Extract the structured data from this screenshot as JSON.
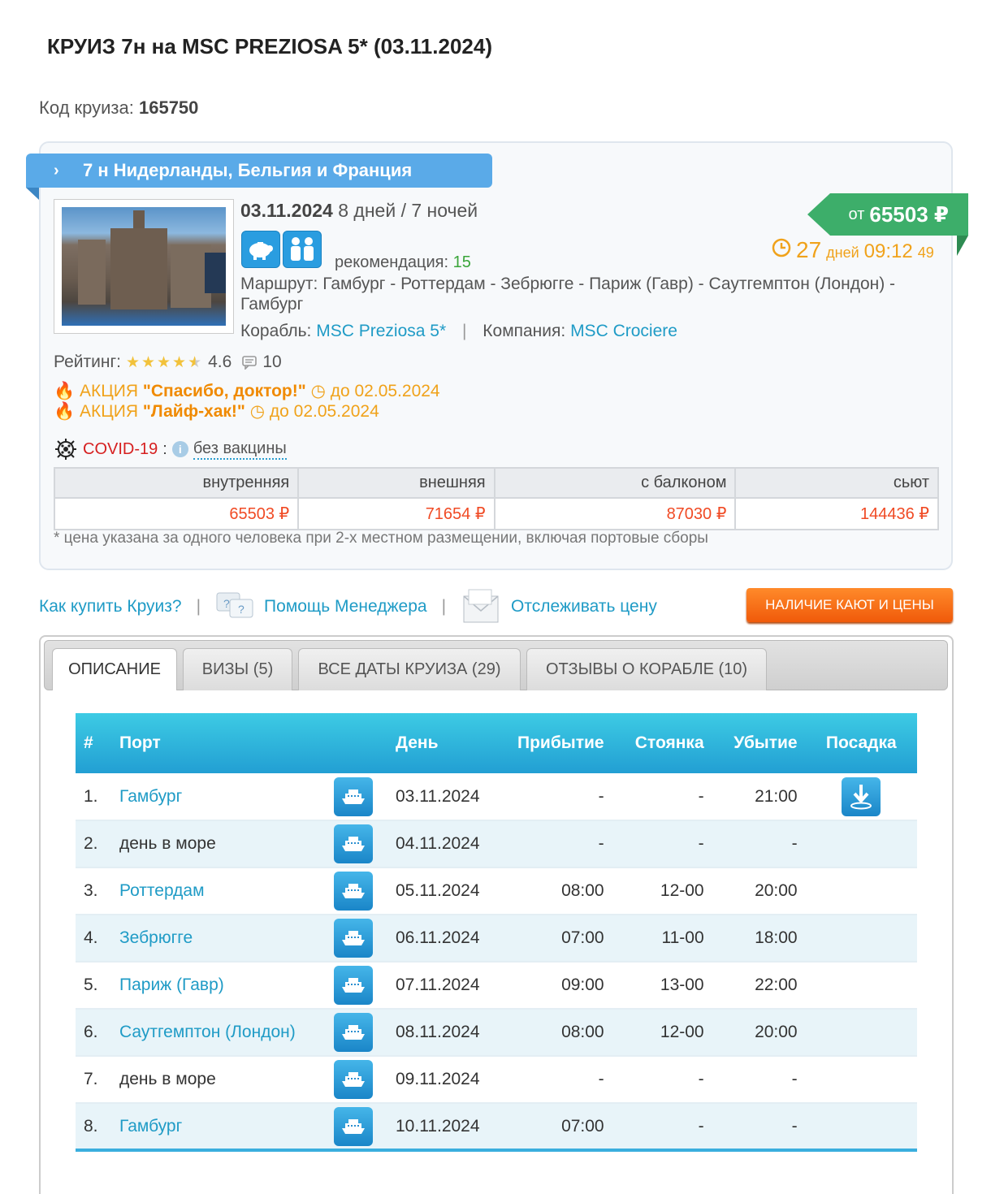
{
  "title": "КРУИЗ 7н на MSC PREZIOSA 5* (03.11.2024)",
  "code_label": "Код круиза:",
  "code_value": "165750",
  "ribbon": "7 н Нидерланды, Бельгия и Франция",
  "date": "03.11.2024",
  "duration": "8 дней / 7 ночей",
  "recommend_label": "рекомендация:",
  "recommend_value": "15",
  "price_from_label": "от",
  "price_from_value": "65503",
  "currency": "₽",
  "countdown": {
    "days": "27",
    "days_label": "дней",
    "time": "09:12",
    "seconds": "49"
  },
  "route_label": "Маршрут:",
  "route_value": "Гамбург - Роттердам - Зебрюгге - Париж (Гавр) - Саутгемптон (Лондон) - Гамбург",
  "ship_label": "Корабль:",
  "ship_value": "MSC Preziosa 5*",
  "company_label": "Компания:",
  "company_value": "MSC Crociere",
  "rating_label": "Рейтинг:",
  "rating_value": "4.6",
  "review_count": "10",
  "rating_stars": 4.5,
  "promos": [
    {
      "prefix": "АКЦИЯ",
      "name": "\"Спасибо, доктор!\"",
      "until": "до 02.05.2024"
    },
    {
      "prefix": "АКЦИЯ",
      "name": "\"Лайф-хак!\"",
      "until": "до 02.05.2024"
    }
  ],
  "covid_label": "COVID-19",
  "covid_sep": ":",
  "covid_value": "без вакцины",
  "cabins": {
    "headers": [
      "внутренняя",
      "внешняя",
      "с балконом",
      "сьют"
    ],
    "prices": [
      "65503",
      "71654",
      "87030",
      "144436"
    ]
  },
  "footnote": "* цена указана за одного человека при 2-х местном размещении, включая портовые сборы",
  "help": {
    "how_to_buy": "Как купить Круиз?",
    "manager_help": "Помощь Менеджера",
    "track_price": "Отслеживать цену",
    "availability_button": "НАЛИЧИЕ КАЮТ И ЦЕНЫ"
  },
  "tabs": [
    "ОПИСАНИЕ",
    "ВИЗЫ (5)",
    "ВСЕ ДАТЫ КРУИЗА (29)",
    "ОТЗЫВЫ О КОРАБЛЕ (10)"
  ],
  "ports_headers": [
    "#",
    "Порт",
    "День",
    "Прибытие",
    "Стоянка",
    "Убытие",
    "Посадка"
  ],
  "ports": [
    {
      "n": "1.",
      "port": "Гамбург",
      "link": true,
      "day": "03.11.2024",
      "arrive": "-",
      "stay": "-",
      "depart": "21:00",
      "boarding": true
    },
    {
      "n": "2.",
      "port": "день в море",
      "link": false,
      "day": "04.11.2024",
      "arrive": "-",
      "stay": "-",
      "depart": "-",
      "boarding": false
    },
    {
      "n": "3.",
      "port": "Роттердам",
      "link": true,
      "day": "05.11.2024",
      "arrive": "08:00",
      "stay": "12-00",
      "depart": "20:00",
      "boarding": false
    },
    {
      "n": "4.",
      "port": "Зебрюгге",
      "link": true,
      "day": "06.11.2024",
      "arrive": "07:00",
      "stay": "11-00",
      "depart": "18:00",
      "boarding": false
    },
    {
      "n": "5.",
      "port": "Париж (Гавр)",
      "link": true,
      "day": "07.11.2024",
      "arrive": "09:00",
      "stay": "13-00",
      "depart": "22:00",
      "boarding": false
    },
    {
      "n": "6.",
      "port": "Саутгемптон (Лондон)",
      "link": true,
      "day": "08.11.2024",
      "arrive": "08:00",
      "stay": "12-00",
      "depart": "20:00",
      "boarding": false
    },
    {
      "n": "7.",
      "port": "день в море",
      "link": false,
      "day": "09.11.2024",
      "arrive": "-",
      "stay": "-",
      "depart": "-",
      "boarding": false
    },
    {
      "n": "8.",
      "port": "Гамбург",
      "link": true,
      "day": "10.11.2024",
      "arrive": "07:00",
      "stay": "-",
      "depart": "-",
      "boarding": false
    }
  ],
  "colors": {
    "accent_blue": "#1f9bc6",
    "orange": "#f0a21a",
    "price_red": "#f04a24",
    "green_tag": "#3dae6a"
  }
}
